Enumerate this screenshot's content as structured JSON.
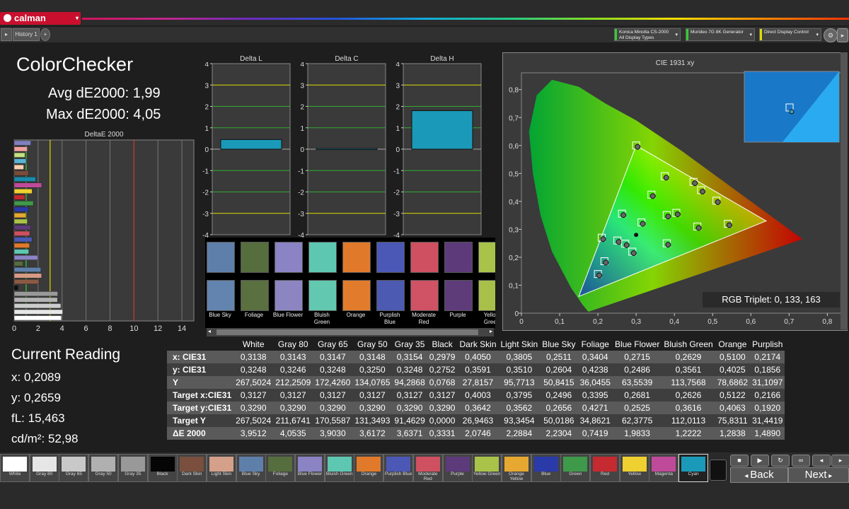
{
  "app": {
    "logo": "calman",
    "history_tab": "History 1"
  },
  "devices": [
    {
      "line1": "Konica Minolta CS-2000",
      "line2": "All Display Types",
      "color": "#33cc33"
    },
    {
      "line1": "Murideo 7G 8K Generator",
      "line2": "",
      "color": "#33cc33"
    },
    {
      "line1": "Direct Display Control",
      "line2": "",
      "color": "#dddd00"
    }
  ],
  "summary": {
    "title": "ColorChecker",
    "avg": "Avg dE2000: 1,99",
    "max": "Max dE2000: 4,05"
  },
  "deltae_chart": {
    "title": "DeltaE 2000",
    "ticks": [
      "0",
      "2",
      "4",
      "6",
      "8",
      "10",
      "12",
      "14"
    ],
    "values": [
      3.95,
      4.05,
      3.9,
      3.62,
      3.64,
      0.33,
      2.07,
      2.29,
      2.23,
      0.74,
      1.98,
      1.22,
      1.28,
      1.49,
      1.3,
      1.4,
      1.1,
      1.0,
      1.2,
      1.6,
      0.9,
      1.5,
      2.3,
      1.8,
      1.2,
      0.8,
      1.0,
      0.9,
      1.1,
      1.4
    ],
    "colors": [
      "#ffffff",
      "#e6e6e6",
      "#cccccc",
      "#b3b3b3",
      "#999999",
      "#111111",
      "#8b5a45",
      "#d69a85",
      "#5f7fab",
      "#566d3e",
      "#8a83c4",
      "#5ec7b2",
      "#e07a2a",
      "#4b58b5",
      "#cf5060",
      "#5d3a7a",
      "#a8c24a",
      "#e6a830",
      "#2a3aa8",
      "#3e9a4a",
      "#c42a30",
      "#eed030",
      "#c04a9a",
      "#1a8aaa",
      "#7a4a3a",
      "#ffd0b0",
      "#5ab4d4",
      "#c5e080",
      "#f0a0a0",
      "#8080c0"
    ]
  },
  "delta_graphs": [
    {
      "title": "Delta L",
      "value": 0.45,
      "ticks": [
        "4",
        "3",
        "2",
        "1",
        "0",
        "-1",
        "-2",
        "-3",
        "-4"
      ]
    },
    {
      "title": "Delta C",
      "value": 0.03,
      "ticks": [
        "4",
        "3",
        "2",
        "1",
        "0",
        "-1",
        "-2",
        "-3",
        "-4"
      ]
    },
    {
      "title": "Delta H",
      "value": 1.8,
      "ticks": [
        "4",
        "3",
        "2",
        "1",
        "0",
        "-1",
        "-2",
        "-3",
        "-4"
      ]
    }
  ],
  "patches": [
    {
      "name": "Blue Sky",
      "top": "#5f7fab",
      "bottom": "#6284ae"
    },
    {
      "name": "Foliage",
      "top": "#566d3e",
      "bottom": "#5a7040"
    },
    {
      "name": "Blue Flower",
      "top": "#8a83c4",
      "bottom": "#8b86c2"
    },
    {
      "name": "Bluish Green",
      "top": "#5ec7b2",
      "bottom": "#62c8b0"
    },
    {
      "name": "Orange",
      "top": "#e07a2a",
      "bottom": "#e27c2c"
    },
    {
      "name": "Purplish Blue",
      "top": "#4b58b5",
      "bottom": "#4c5ab2"
    },
    {
      "name": "Moderate Red",
      "top": "#cf5060",
      "bottom": "#cf5265"
    },
    {
      "name": "Purple",
      "top": "#5d3a7a",
      "bottom": "#5e3c7a"
    },
    {
      "name": "Yellow Green",
      "top": "#a8c24a",
      "bottom": "#a8c04a"
    }
  ],
  "cie": {
    "title": "CIE 1931 xy",
    "triplet": "RGB Triplet: 0, 133, 163",
    "xticks": [
      "0",
      "0,1",
      "0,2",
      "0,3",
      "0,4",
      "0,5",
      "0,6",
      "0,7",
      "0,8"
    ],
    "yticks": [
      "0,8",
      "0,7",
      "0,6",
      "0,5",
      "0,4",
      "0,3",
      "0,2",
      "0,1",
      "0"
    ]
  },
  "reading": {
    "title": "Current Reading",
    "x": "x: 0,2089",
    "y": "y: 0,2659",
    "fl": "fL: 15,463",
    "cd": "cd/m²: 52,98"
  },
  "table": {
    "headers": [
      "",
      "White",
      "Gray 80",
      "Gray 65",
      "Gray 50",
      "Gray 35",
      "Black",
      "Dark Skin",
      "Light Skin",
      "Blue Sky",
      "Foliage",
      "Blue Flower",
      "Bluish Green",
      "Orange",
      "Purplish"
    ],
    "rows": [
      [
        "x: CIE31",
        "0,3138",
        "0,3143",
        "0,3147",
        "0,3148",
        "0,3154",
        "0,2979",
        "0,4050",
        "0,3805",
        "0,2511",
        "0,3404",
        "0,2715",
        "0,2629",
        "0,5100",
        "0,2174"
      ],
      [
        "y: CIE31",
        "0,3248",
        "0,3246",
        "0,3248",
        "0,3250",
        "0,3248",
        "0,2752",
        "0,3591",
        "0,3510",
        "0,2604",
        "0,4238",
        "0,2486",
        "0,3561",
        "0,4025",
        "0,1856"
      ],
      [
        "Y",
        "267,5024",
        "212,2509",
        "172,4260",
        "134,0765",
        "94,2868",
        "0,0768",
        "27,8157",
        "95,7713",
        "50,8415",
        "36,0455",
        "63,5539",
        "113,7568",
        "78,6862",
        "31,1097"
      ],
      [
        "Target x:CIE31",
        "0,3127",
        "0,3127",
        "0,3127",
        "0,3127",
        "0,3127",
        "0,3127",
        "0,4003",
        "0,3795",
        "0,2496",
        "0,3395",
        "0,2681",
        "0,2626",
        "0,5122",
        "0,2166"
      ],
      [
        "Target y:CIE31",
        "0,3290",
        "0,3290",
        "0,3290",
        "0,3290",
        "0,3290",
        "0,3290",
        "0,3642",
        "0,3562",
        "0,2656",
        "0,4271",
        "0,2525",
        "0,3616",
        "0,4063",
        "0,1920"
      ],
      [
        "Target Y",
        "267,5024",
        "211,6741",
        "170,5587",
        "131,3493",
        "91,4629",
        "0,0000",
        "26,9463",
        "93,3454",
        "50,0186",
        "34,8621",
        "62,3775",
        "112,0113",
        "75,8311",
        "31,4419"
      ],
      [
        "ΔE 2000",
        "3,9512",
        "4,0535",
        "3,9030",
        "3,6172",
        "3,6371",
        "0,3331",
        "2,0746",
        "2,2884",
        "2,2304",
        "0,7419",
        "1,9833",
        "1,2222",
        "1,2838",
        "1,4890"
      ]
    ]
  },
  "swatches": [
    {
      "label": "White",
      "color": "#ffffff"
    },
    {
      "label": "Gray 80",
      "color": "#e6e6e6"
    },
    {
      "label": "Gray 65",
      "color": "#c8c8c8"
    },
    {
      "label": "Gray 50",
      "color": "#b0b0b0"
    },
    {
      "label": "Gray 35",
      "color": "#999999"
    },
    {
      "label": "Black",
      "color": "#050505"
    },
    {
      "label": "Dark Skin",
      "color": "#7a4f3e"
    },
    {
      "label": "Light Skin",
      "color": "#d4a08a"
    },
    {
      "label": "Blue Sky",
      "color": "#5f7fab"
    },
    {
      "label": "Foliage",
      "color": "#566d3e"
    },
    {
      "label": "Blue Flower",
      "color": "#8a83c4"
    },
    {
      "label": "Bluish Green",
      "color": "#5ec7b2"
    },
    {
      "label": "Orange",
      "color": "#e07a2a"
    },
    {
      "label": "Purplish Blue",
      "color": "#4b58b5"
    },
    {
      "label": "Moderate Red",
      "color": "#cf5060"
    },
    {
      "label": "Purple",
      "color": "#5d3a7a"
    },
    {
      "label": "Yellow Green",
      "color": "#a8c24a"
    },
    {
      "label": "Orange Yellow",
      "color": "#e6a830"
    },
    {
      "label": "Blue",
      "color": "#2a3aa8"
    },
    {
      "label": "Green",
      "color": "#3e9a4a"
    },
    {
      "label": "Red",
      "color": "#c42a30"
    },
    {
      "label": "Yellow",
      "color": "#eed030"
    },
    {
      "label": "Magenta",
      "color": "#c04a9a"
    },
    {
      "label": "Cyan",
      "color": "#1a9ab8"
    }
  ],
  "nav": {
    "back": "Back",
    "next": "Next"
  }
}
